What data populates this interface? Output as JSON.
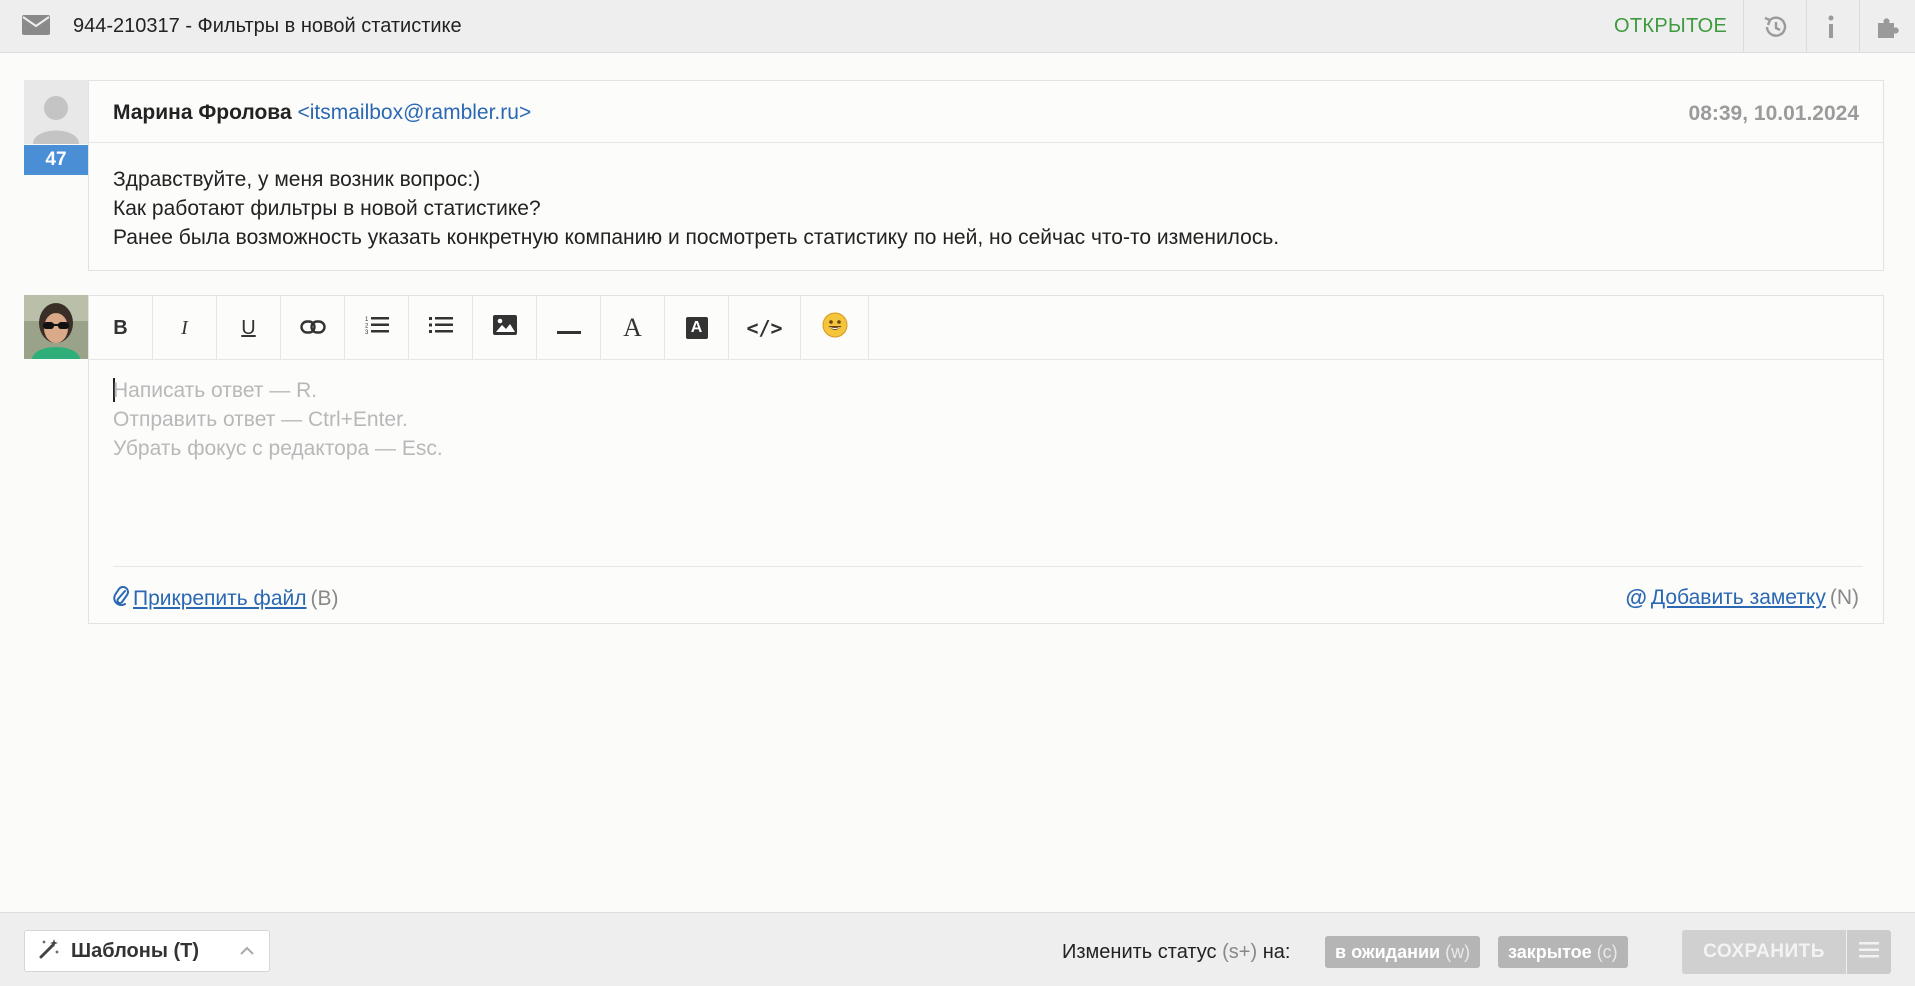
{
  "header": {
    "ticket_title": "944-210317 - Фильтры в новой статистике",
    "status": "ОТКРЫТОЕ",
    "icons": [
      "mail-icon",
      "history-icon",
      "info-icon",
      "plugin-icon"
    ]
  },
  "message": {
    "count": "47",
    "author_name": "Марина Фролова",
    "author_email": "<itsmailbox@rambler.ru>",
    "datetime": "08:39, 10.01.2024",
    "lines": [
      "Здравствуйте, у меня возник вопрос:)",
      "Как работают фильтры в новой статистике?",
      "Ранее была возможность указать конкретную компанию и посмотреть статистику по ней, но сейчас что-то изменилось."
    ]
  },
  "editor": {
    "toolbar": [
      {
        "name": "bold-button",
        "label": "B"
      },
      {
        "name": "italic-button",
        "label": "I"
      },
      {
        "name": "underline-button",
        "label": "U"
      },
      {
        "name": "link-button",
        "icon": "link-icon"
      },
      {
        "name": "ordered-list-button",
        "icon": "ordered-list-icon"
      },
      {
        "name": "unordered-list-button",
        "icon": "unordered-list-icon"
      },
      {
        "name": "image-button",
        "icon": "image-icon"
      },
      {
        "name": "horizontal-rule-button",
        "icon": "horizontal-rule-icon"
      },
      {
        "name": "font-color-button",
        "label": "A"
      },
      {
        "name": "background-color-button",
        "label": "A"
      },
      {
        "name": "code-button",
        "label": "</>"
      },
      {
        "name": "emoji-button",
        "icon": "emoji-icon"
      }
    ],
    "placeholder_lines": [
      "Написать ответ — R.",
      "Отправить ответ — Ctrl+Enter.",
      "Убрать фокус с редактора — Esc."
    ],
    "attach_label": "Прикрепить файл",
    "attach_hint": "(B)",
    "note_label": "Добавить заметку",
    "note_hint": "(N)"
  },
  "footer": {
    "templates_label": "Шаблоны (T)",
    "change_status_label": "Изменить статус",
    "change_status_hint": "(s+)",
    "change_status_suffix": "на:",
    "status_pending": "в ожидании",
    "status_pending_key": "(w)",
    "status_closed": "закрытое",
    "status_closed_key": "(c)",
    "save_label": "СОХРАНИТЬ"
  },
  "colors": {
    "status_open": "#3e9a3e",
    "link": "#2a68b3",
    "badge": "#4a8fd6"
  }
}
